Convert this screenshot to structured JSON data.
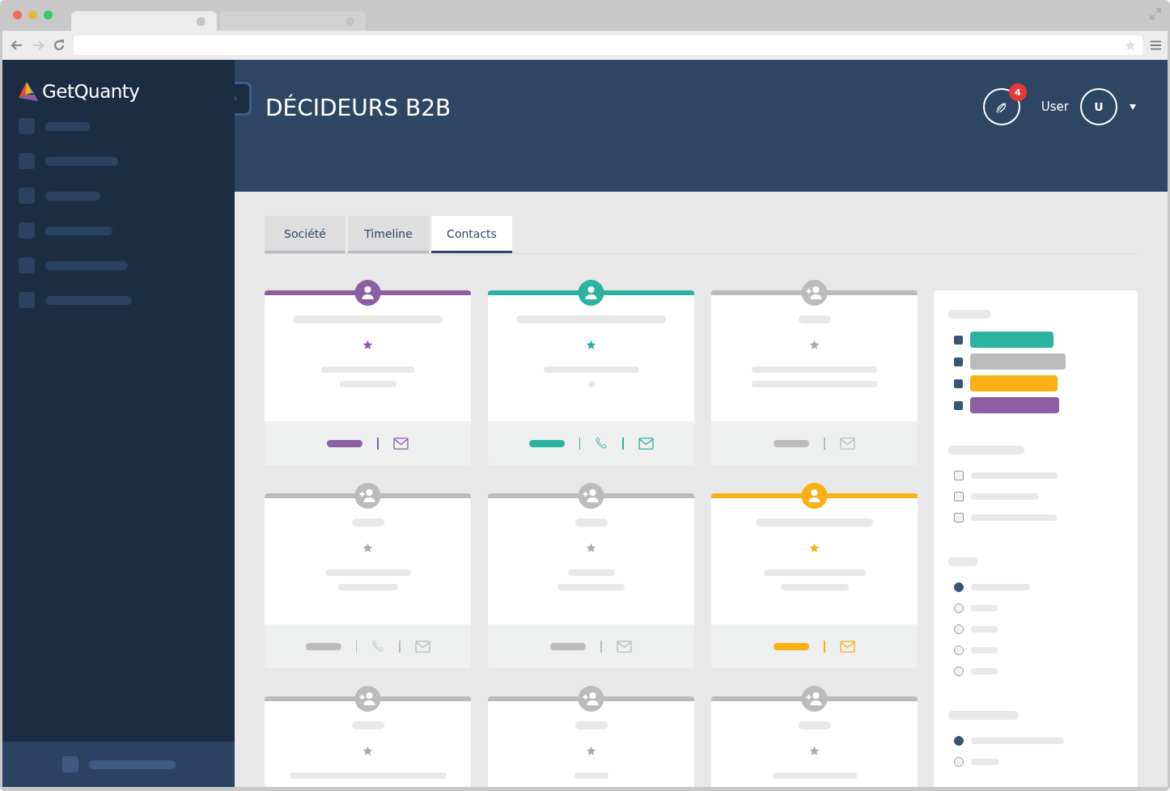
{
  "browser": {
    "tabs": [
      {
        "selected": true
      },
      {
        "selected": false
      }
    ]
  },
  "brand": {
    "name": "GetQuanty"
  },
  "header": {
    "title": "DÉCIDEURS B2B",
    "notifications": {
      "count": "4"
    },
    "user": {
      "name": "User",
      "initial": "U"
    }
  },
  "tabs": [
    {
      "label": "Société",
      "selected": false
    },
    {
      "label": "Timeline",
      "selected": false
    },
    {
      "label": "Contacts",
      "selected": true
    }
  ],
  "cards": [
    {
      "kind": "contact",
      "color": "#8e5ea2",
      "phone": false
    },
    {
      "kind": "contact",
      "color": "#2bb3a0",
      "phone": true
    },
    {
      "kind": "prospect",
      "color": "#bbbbbb",
      "phone": false
    },
    {
      "kind": "prospect",
      "color": "#bbbbbb",
      "phone": true
    },
    {
      "kind": "prospect",
      "color": "#bbbbbb",
      "phone": false
    },
    {
      "kind": "contact",
      "color": "#f8b015",
      "phone": false
    },
    {
      "kind": "prospect",
      "color": "#bbbbbb"
    },
    {
      "kind": "prospect",
      "color": "#bbbbbb"
    },
    {
      "kind": "prospect",
      "color": "#bbbbbb"
    }
  ],
  "filters": {
    "tags": [
      {
        "color": "#2bb3a0"
      },
      {
        "color": "#bbbbbb"
      },
      {
        "color": "#f8b015"
      },
      {
        "color": "#8e5ea2"
      }
    ],
    "checks": [
      {
        "checked": false
      },
      {
        "checked": false
      },
      {
        "checked": false
      }
    ],
    "radios": [
      {
        "selected": true
      },
      {
        "selected": false
      },
      {
        "selected": false
      },
      {
        "selected": false
      },
      {
        "selected": false
      }
    ],
    "radios_2": [
      {
        "selected": true
      },
      {
        "selected": false
      }
    ]
  }
}
